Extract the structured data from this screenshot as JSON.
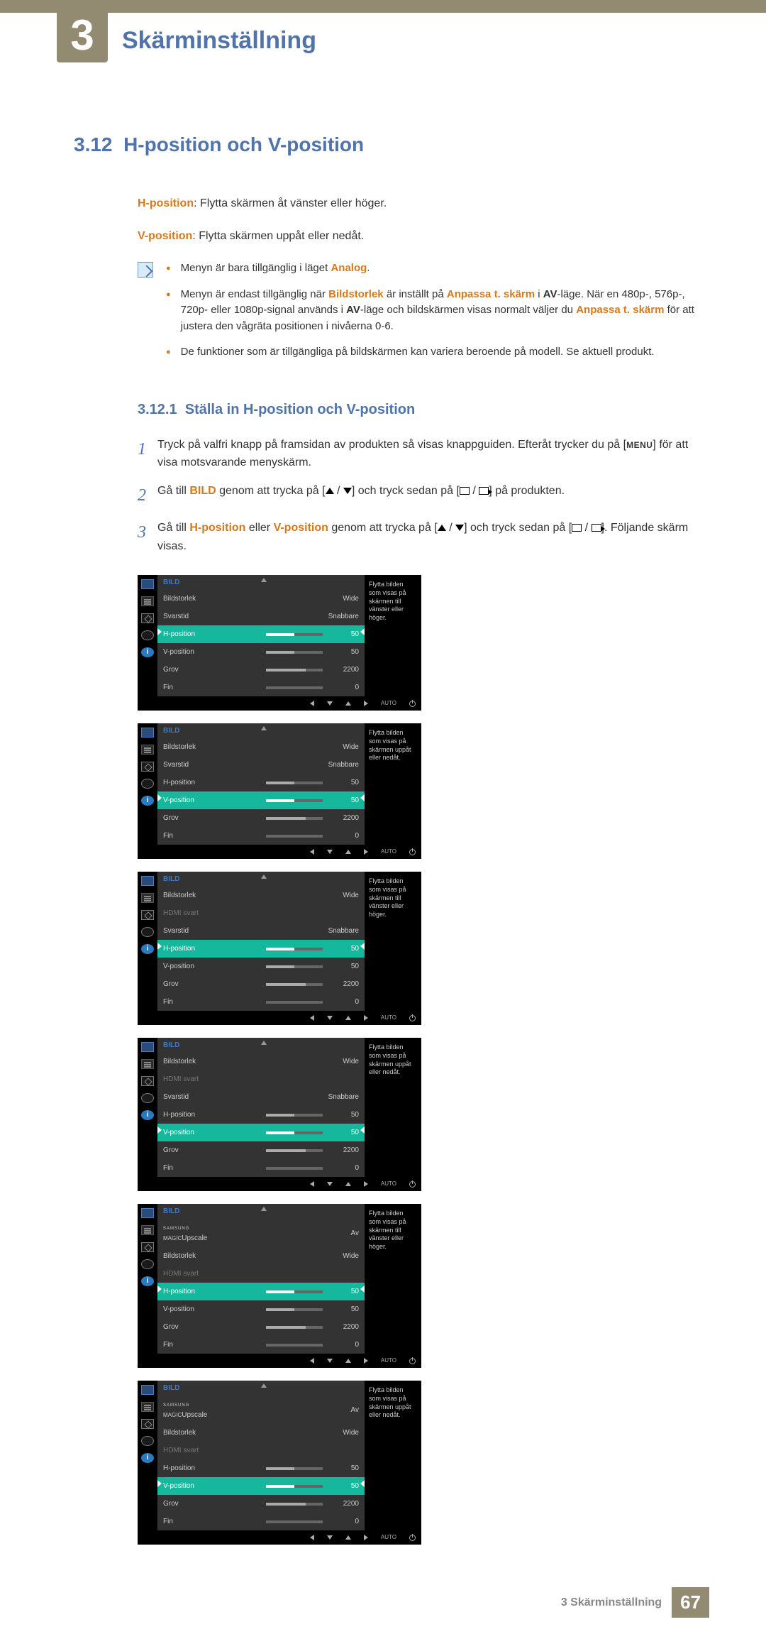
{
  "chapter": {
    "num": "3",
    "title": "Skärminställning"
  },
  "section": {
    "num": "3.12",
    "title": "H-position och V-position",
    "hpos_label": "H-position",
    "hpos_desc": ": Flytta skärmen åt vänster eller höger.",
    "vpos_label": "V-position",
    "vpos_desc": ": Flytta skärmen uppåt eller nedåt."
  },
  "notes": {
    "n1a": "Menyn är bara tillgänglig i läget ",
    "n1b": "Analog",
    "n1c": ".",
    "n2a": "Menyn är endast tillgänglig när ",
    "n2b": "Bildstorlek",
    "n2c": " är inställt på ",
    "n2d": "Anpassa t. skärm",
    "n2e": " i ",
    "n2f": "AV",
    "n2g": "-läge. När en 480p-, 576p-, 720p- eller 1080p-signal används i ",
    "n2h": "AV",
    "n2i": "-läge och bildskärmen visas normalt väljer du ",
    "n2j": "Anpassa t. skärm",
    "n2k": " för att justera den vågräta positionen i nivåerna 0-6.",
    "n3": "De funktioner som är tillgängliga på bildskärmen kan variera beroende på modell. Se aktuell produkt."
  },
  "subsection": {
    "num": "3.12.1",
    "title": "Ställa in H-position och V-position"
  },
  "steps": {
    "s1a": "Tryck på valfri knapp på framsidan av produkten så visas knappguiden. Efteråt trycker du på [",
    "s1b": "] för att visa motsvarande menyskärm.",
    "menu_btn": "MENU",
    "s2a": "Gå till ",
    "s2b": "BILD",
    "s2c": " genom att trycka på [",
    "s2d": "] och tryck sedan på [",
    "s2e": "] på produkten.",
    "s3a": "Gå till ",
    "s3b": "H-position",
    "s3c": " eller ",
    "s3d": "V-position",
    "s3e": " genom att trycka på [",
    "s3f": "] och tryck sedan på [",
    "s3g": "]. Följande skärm visas."
  },
  "osd": {
    "title": "BILD",
    "help_h": "Flytta bilden som visas på skärmen till vänster eller höger.",
    "help_v": "Flytta bilden som visas på skärmen uppåt eller nedåt.",
    "rows_a": [
      {
        "label": "Bildstorlek",
        "val": "Wide",
        "bar": null
      },
      {
        "label": "Svarstid",
        "val": "Snabbare",
        "bar": null
      },
      {
        "label": "H-position",
        "val": "50",
        "bar": 50,
        "sel": "h"
      },
      {
        "label": "V-position",
        "val": "50",
        "bar": 50,
        "sel": "v"
      },
      {
        "label": "Grov",
        "val": "2200",
        "bar": 70
      },
      {
        "label": "Fin",
        "val": "0",
        "bar": 0
      }
    ],
    "rows_b": [
      {
        "label": "Bildstorlek",
        "val": "Wide",
        "bar": null
      },
      {
        "label": "HDMI svart",
        "val": "",
        "bar": null,
        "dim": true
      },
      {
        "label": "Svarstid",
        "val": "Snabbare",
        "bar": null
      },
      {
        "label": "H-position",
        "val": "50",
        "bar": 50,
        "sel": "h"
      },
      {
        "label": "V-position",
        "val": "50",
        "bar": 50,
        "sel": "v"
      },
      {
        "label": "Grov",
        "val": "2200",
        "bar": 70
      },
      {
        "label": "Fin",
        "val": "0",
        "bar": 0
      }
    ],
    "rows_c": [
      {
        "label": "MAGIC Upscale",
        "val": "Av",
        "bar": null,
        "magic": true
      },
      {
        "label": "Bildstorlek",
        "val": "Wide",
        "bar": null
      },
      {
        "label": "HDMI svart",
        "val": "",
        "bar": null,
        "dim": true
      },
      {
        "label": "H-position",
        "val": "50",
        "bar": 50,
        "sel": "h"
      },
      {
        "label": "V-position",
        "val": "50",
        "bar": 50,
        "sel": "v"
      },
      {
        "label": "Grov",
        "val": "2200",
        "bar": 70
      },
      {
        "label": "Fin",
        "val": "0",
        "bar": 0
      }
    ],
    "auto": "AUTO",
    "i": "i"
  },
  "footer": {
    "label": "3 Skärminställning",
    "page": "67"
  }
}
